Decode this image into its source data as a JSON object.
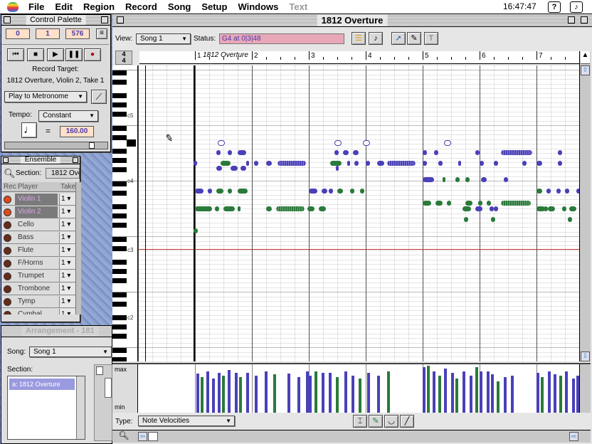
{
  "menubar": {
    "items": [
      "File",
      "Edit",
      "Region",
      "Record",
      "Song",
      "Setup",
      "Windows",
      "Text"
    ],
    "clock": "16:47:47",
    "help_glyph": "?",
    "app_glyph": "♪"
  },
  "control_palette": {
    "title": "Control Palette",
    "position": {
      "bars": "0",
      "beats": "1",
      "ticks": "576"
    },
    "record_target_label": "Record Target:",
    "record_target_value": "1812 Overture, Violin 2, Take 1",
    "metronome": "Play to Metronome",
    "tempo_label": "Tempo:",
    "tempo_mode": "Constant",
    "tempo_value": "160.00",
    "equals": "="
  },
  "ensemble": {
    "title": "Ensemble",
    "section_label": "Section:",
    "section_value": "1812 Ove",
    "columns": {
      "rec": "Rec",
      "player": "Player",
      "take": "Take"
    },
    "players": [
      {
        "name": "Violin 1",
        "take": "1",
        "active": true
      },
      {
        "name": "Violin 2",
        "take": "1",
        "active": true
      },
      {
        "name": "Cello",
        "take": "1",
        "active": false
      },
      {
        "name": "Bass",
        "take": "1",
        "active": false
      },
      {
        "name": "Flute",
        "take": "1",
        "active": false
      },
      {
        "name": "F/Horns",
        "take": "1",
        "active": false
      },
      {
        "name": "Trumpet",
        "take": "1",
        "active": false
      },
      {
        "name": "Trombone",
        "take": "1",
        "active": false
      },
      {
        "name": "Tymp",
        "take": "1",
        "active": false
      },
      {
        "name": "Cymbal",
        "take": "1",
        "active": false
      }
    ]
  },
  "arrangement": {
    "title": "Arrangement - 181",
    "song_label": "Song:",
    "song_value": "Song 1",
    "section_label": "Section:",
    "section_item": "a: 1812 Overture"
  },
  "editor": {
    "title": "1812 Overture",
    "view_label": "View:",
    "view_value": "Song 1",
    "status_label": "Status:",
    "status_value": "G4 at 0|3|48",
    "time_sig_top": "4",
    "time_sig_bottom": "4",
    "region_label": "1812 Overture",
    "measures": [
      "1",
      "2",
      "3",
      "4",
      "5",
      "6",
      "7"
    ],
    "octave_labels": [
      "c5",
      "c4",
      "c3",
      "c2"
    ],
    "velocity_max": "max",
    "velocity_min": "min",
    "type_label": "Type:",
    "type_value": "Note Velocities"
  },
  "colors": {
    "note_blue": "#4a40b8",
    "note_green": "#2a7a3a",
    "lcd_bg": "#ffe0c8",
    "lcd_text": "#4a3aa8",
    "status_bg": "#e8a8b8",
    "c3_line": "#c03030"
  }
}
